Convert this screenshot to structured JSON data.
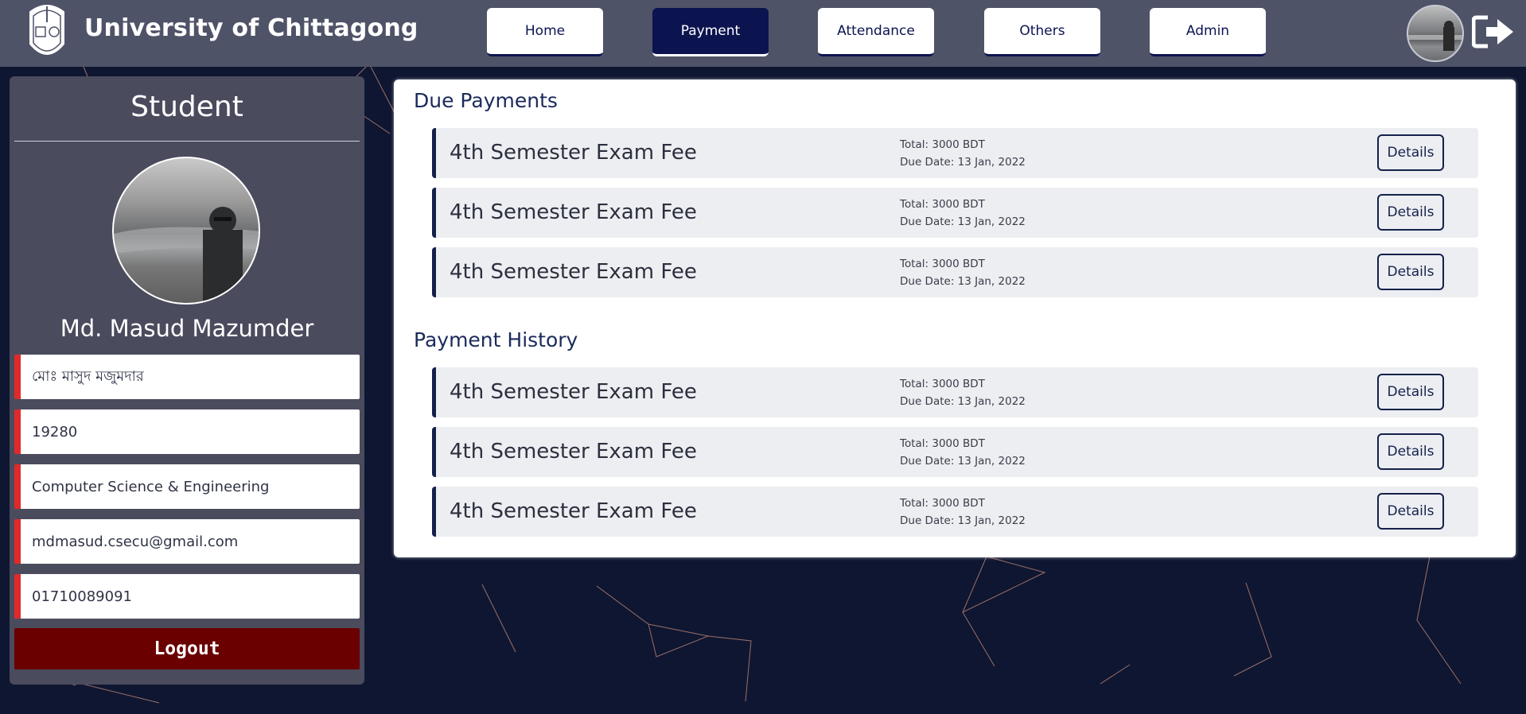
{
  "header": {
    "brand": "University of Chittagong",
    "nav": [
      {
        "label": "Home",
        "active": false
      },
      {
        "label": "Payment",
        "active": true
      },
      {
        "label": "Attendance",
        "active": false
      },
      {
        "label": "Others",
        "active": false
      },
      {
        "label": "Admin",
        "active": false
      }
    ],
    "icons": {
      "logo": "university-logo-icon",
      "avatar": "user-avatar",
      "logout": "logout-arrow-icon"
    }
  },
  "sidebar": {
    "title": "Student",
    "name": "Md. Masud Mazumder",
    "fields": {
      "bangla_name": "মোঃ মাসুদ মজুমদার",
      "id": "19280",
      "department": "Computer Science & Engineering",
      "email": "mdmasud.csecu@gmail.com",
      "phone": "01710089091"
    },
    "logout_label": "Logout"
  },
  "main": {
    "due_title": "Due Payments",
    "history_title": "Payment History",
    "details_label": "Details",
    "due": [
      {
        "title": "4th Semester Exam Fee",
        "total": "Total: 3000 BDT",
        "due_date": "Due Date: 13 Jan, 2022"
      },
      {
        "title": "4th Semester Exam Fee",
        "total": "Total: 3000 BDT",
        "due_date": "Due Date: 13 Jan, 2022"
      },
      {
        "title": "4th Semester Exam Fee",
        "total": "Total: 3000 BDT",
        "due_date": "Due Date: 13 Jan, 2022"
      }
    ],
    "history": [
      {
        "title": "4th Semester Exam Fee",
        "total": "Total: 3000 BDT",
        "due_date": "Due Date: 13 Jan, 2022"
      },
      {
        "title": "4th Semester Exam Fee",
        "total": "Total: 3000 BDT",
        "due_date": "Due Date: 13 Jan, 2022"
      },
      {
        "title": "4th Semester Exam Fee",
        "total": "Total: 3000 BDT",
        "due_date": "Due Date: 13 Jan, 2022"
      }
    ]
  },
  "colors": {
    "background": "#0f1631",
    "header": "#4f5368",
    "sidebar": "#4b4b5e",
    "accent_navy": "#0c1450",
    "field_accent": "#e02a2a",
    "logout": "#6a0000"
  }
}
